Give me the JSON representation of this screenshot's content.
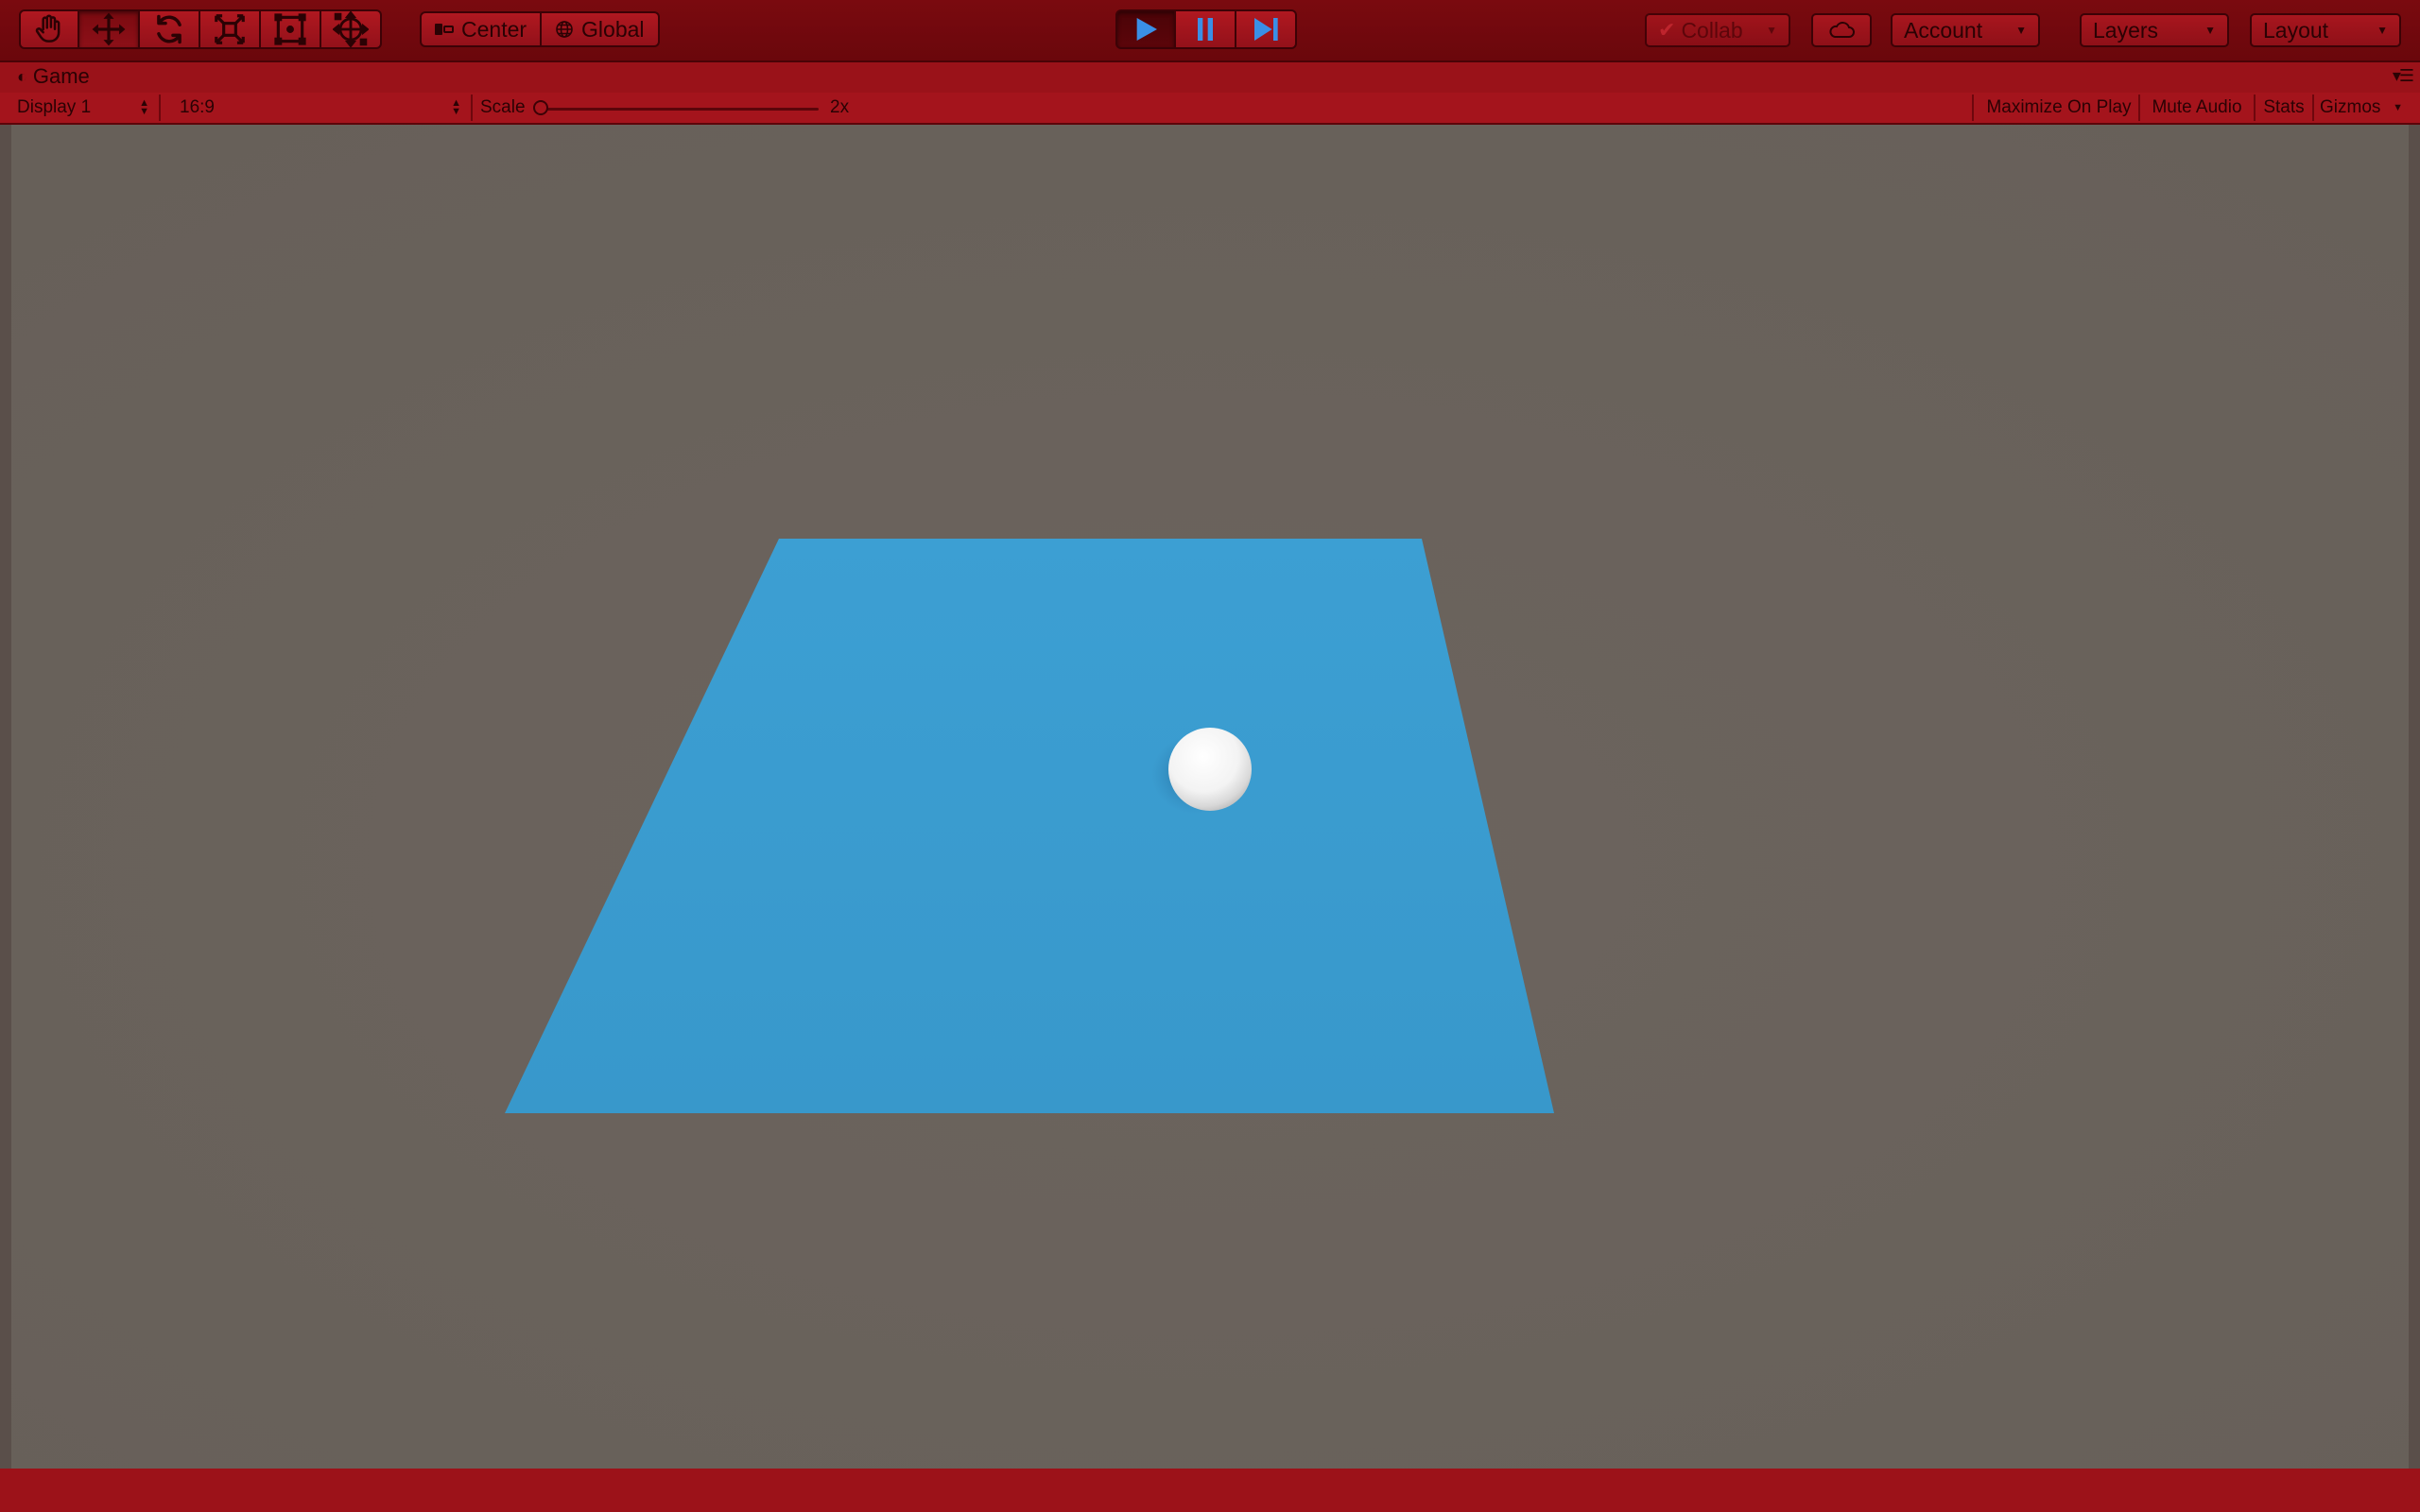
{
  "toolbar": {
    "transform_tools": [
      {
        "name": "hand-tool",
        "icon": "hand-icon",
        "active": false
      },
      {
        "name": "move-tool",
        "icon": "move-arrows-icon",
        "active": true
      },
      {
        "name": "rotate-tool",
        "icon": "rotate-icon",
        "active": false
      },
      {
        "name": "scale-tool",
        "icon": "scale-icon",
        "active": false
      },
      {
        "name": "rect-tool",
        "icon": "rect-transform-icon",
        "active": false
      },
      {
        "name": "transform-tool",
        "icon": "combined-transform-icon",
        "active": false
      }
    ],
    "pivot_label": "Center",
    "space_label": "Global",
    "play_controls": [
      {
        "name": "play-button",
        "icon": "play-icon",
        "active": true
      },
      {
        "name": "pause-button",
        "icon": "pause-icon",
        "active": false
      },
      {
        "name": "step-button",
        "icon": "step-icon",
        "active": false
      }
    ],
    "collab_label": "Collab",
    "account_label": "Account",
    "layers_label": "Layers",
    "layout_label": "Layout"
  },
  "tab": {
    "title": "Game"
  },
  "gamebar": {
    "display": "Display 1",
    "aspect": "16:9",
    "scale_label": "Scale",
    "scale_value": "2x",
    "maximize_label": "Maximize On Play",
    "mute_label": "Mute Audio",
    "stats_label": "Stats",
    "gizmos_label": "Gizmos"
  },
  "colors": {
    "playmode_tint": "#8a0d12",
    "background": "#6a625c",
    "plane": "#3a9bd0",
    "sphere": "#ffffff",
    "play_icon": "#3a8fe6"
  }
}
